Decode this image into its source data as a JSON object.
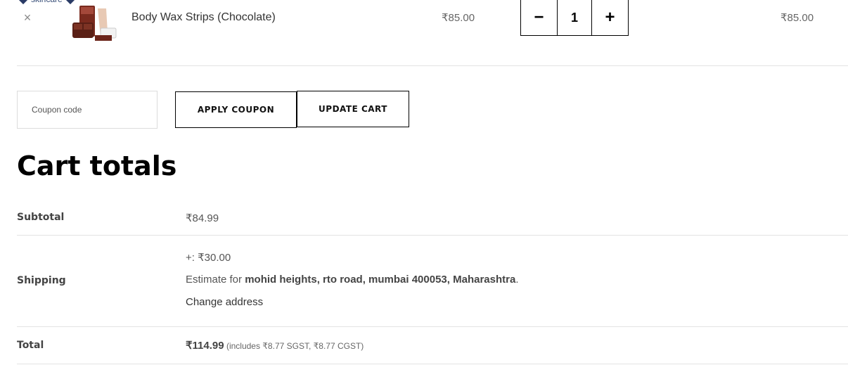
{
  "logo": {
    "text": "skincare"
  },
  "cart_item": {
    "remove_symbol": "×",
    "name": "Body Wax Strips (Chocolate)",
    "price": "₹85.00",
    "quantity": "1",
    "decrement_symbol": "−",
    "increment_symbol": "+",
    "line_total": "₹85.00"
  },
  "coupon": {
    "placeholder": "Coupon code",
    "apply_label": "APPLY COUPON",
    "update_label": "UPDATE CART"
  },
  "totals": {
    "title": "Cart totals",
    "subtotal_label": "Subtotal",
    "subtotal_value": "₹84.99",
    "shipping_label": "Shipping",
    "shipping_rate": "+: ₹30.00",
    "estimate_prefix": "Estimate for ",
    "estimate_address": "mohid heights, rto road, mumbai 400053, Maharashtra",
    "estimate_suffix": ".",
    "change_address": "Change address",
    "total_label": "Total",
    "total_value": "₹114.99",
    "tax_note": " (includes ₹8.77 SGST, ₹8.77 CGST)"
  },
  "colors": {
    "accent": "#000000",
    "divider": "#e3e3e3",
    "brand": "#2a3b66"
  }
}
